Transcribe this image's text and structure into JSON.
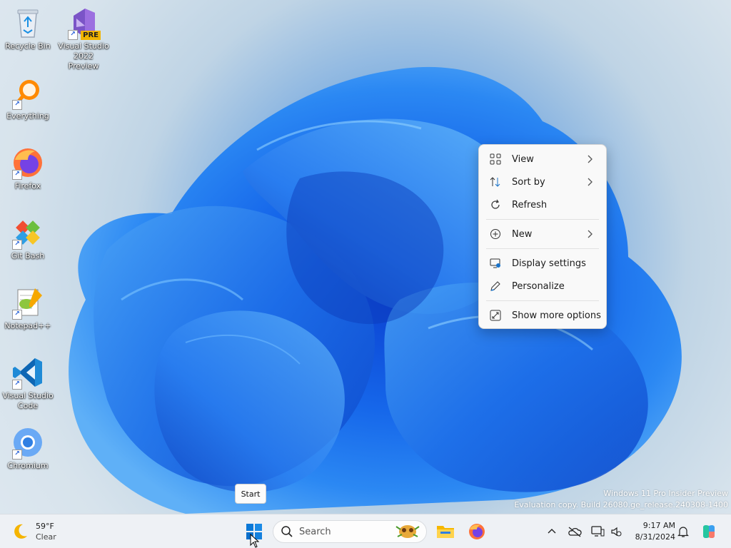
{
  "desktop": {
    "icons": [
      {
        "label": "Recycle Bin",
        "icon": "recycle-bin-icon"
      },
      {
        "label": "Visual Studio 2022 Preview",
        "icon": "visual-studio-preview-icon",
        "badge": "PRE"
      },
      {
        "label": "Everything",
        "icon": "everything-search-icon"
      },
      {
        "label": "Firefox",
        "icon": "firefox-icon"
      },
      {
        "label": "Git Bash",
        "icon": "git-bash-icon"
      },
      {
        "label": "Notepad++",
        "icon": "notepad-plus-plus-icon"
      },
      {
        "label": "Visual Studio Code",
        "icon": "vscode-icon"
      },
      {
        "label": "Chromium",
        "icon": "chromium-icon"
      }
    ]
  },
  "context_menu": {
    "items": [
      {
        "label": "View",
        "icon": "grid-view-icon",
        "has_submenu": true
      },
      {
        "label": "Sort by",
        "icon": "sort-icon",
        "has_submenu": true
      },
      {
        "label": "Refresh",
        "icon": "refresh-icon",
        "has_submenu": false
      },
      {
        "label": "New",
        "icon": "plus-circle-icon",
        "has_submenu": true
      },
      {
        "label": "Display settings",
        "icon": "display-settings-icon",
        "has_submenu": false
      },
      {
        "label": "Personalize",
        "icon": "pen-icon",
        "has_submenu": false
      },
      {
        "label": "Show more options",
        "icon": "expand-icon",
        "has_submenu": false
      }
    ]
  },
  "tooltip": {
    "text": "Start"
  },
  "watermark": {
    "line1": "Windows 11 Pro Insider Preview",
    "line2": "Evaluation copy. Build 26080.ge_release.240308-1400"
  },
  "taskbar": {
    "weather": {
      "temp": "59°F",
      "condition": "Clear",
      "icon": "moon-icon"
    },
    "search": {
      "placeholder": "Search"
    },
    "apps": [
      {
        "name": "File Explorer",
        "icon": "folder-icon"
      },
      {
        "name": "Firefox",
        "icon": "firefox-icon"
      }
    ],
    "clock": {
      "time": "9:17 AM",
      "date": "8/31/2024"
    }
  },
  "colors": {
    "accent": "#0067c0",
    "menu_bg": "#f9f9f9",
    "taskbar_bg": "#eef1f5"
  }
}
